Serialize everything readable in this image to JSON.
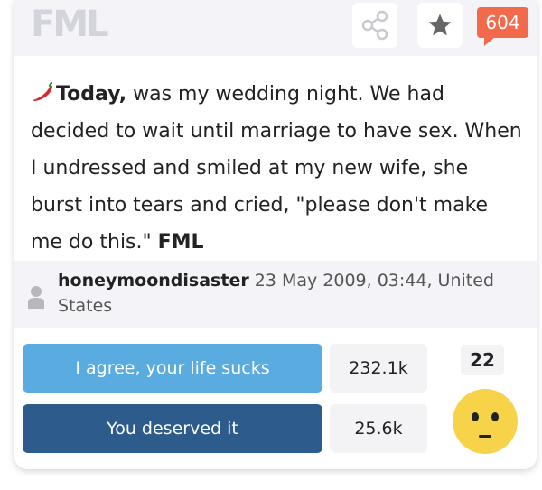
{
  "header": {
    "logo": "FML",
    "count_badge": "604"
  },
  "story": {
    "lead": "Today,",
    "body": " was my wedding night. We had decided to wait until marriage to have sex. When I undressed and smiled at my new wife, she burst into tears and cried, \"please don't make me do this.\" ",
    "tag": "FML"
  },
  "meta": {
    "username": "honeymoondisaster",
    "date_location": " 23 May 2009, 03:44, United States"
  },
  "votes": {
    "agree_label": "I agree, your life sucks",
    "agree_count": "232.1k",
    "deserved_label": "You deserved it",
    "deserved_count": "25.6k"
  },
  "reaction": {
    "count": "22",
    "icon": "neutral-face-icon"
  },
  "colors": {
    "badge": "#f26a4b",
    "agree": "#5aabe0",
    "deserved": "#2d5b8b",
    "emoji": "#f7d34a"
  },
  "icons": [
    "share-icon",
    "star-icon",
    "chili-pepper-icon",
    "user-icon",
    "neutral-face-icon"
  ]
}
